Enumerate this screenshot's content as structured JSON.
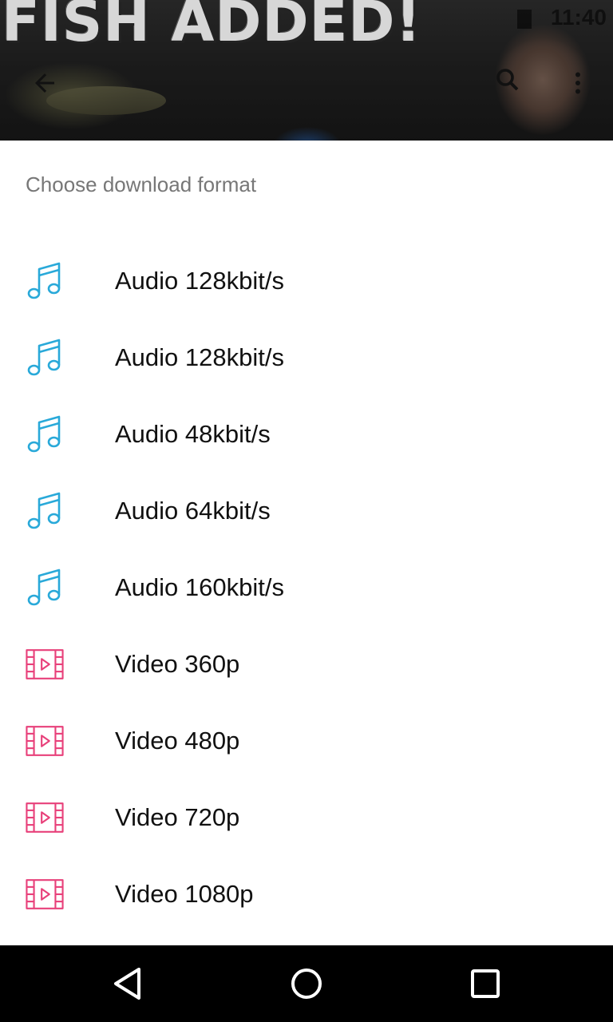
{
  "thumbnail": {
    "title_text": "FISH ADDED!",
    "status_time": "11:40"
  },
  "toolbar": {
    "back_icon": "arrow-back-icon",
    "search_icon": "search-icon",
    "more_icon": "more-vert-icon"
  },
  "sheet": {
    "title": "Choose download format",
    "formats": [
      {
        "label": "Audio 128kbit/s",
        "icon": "music-note-icon",
        "kind": "audio"
      },
      {
        "label": "Audio 128kbit/s",
        "icon": "music-note-icon",
        "kind": "audio"
      },
      {
        "label": "Audio 48kbit/s",
        "icon": "music-note-icon",
        "kind": "audio"
      },
      {
        "label": "Audio 64kbit/s",
        "icon": "music-note-icon",
        "kind": "audio"
      },
      {
        "label": "Audio 160kbit/s",
        "icon": "music-note-icon",
        "kind": "audio"
      },
      {
        "label": "Video 360p",
        "icon": "film-icon",
        "kind": "video"
      },
      {
        "label": "Video 480p",
        "icon": "film-icon",
        "kind": "video"
      },
      {
        "label": "Video 720p",
        "icon": "film-icon",
        "kind": "video"
      },
      {
        "label": "Video 1080p",
        "icon": "film-icon",
        "kind": "video"
      }
    ]
  },
  "navbar": {
    "back_icon": "nav-back-icon",
    "home_icon": "nav-home-icon",
    "recents_icon": "nav-recents-icon"
  },
  "colors": {
    "audio_icon": "#29a9d9",
    "video_icon": "#e8407a",
    "label_text": "#111111",
    "title_text": "#777777",
    "navbar_bg": "#000000"
  }
}
